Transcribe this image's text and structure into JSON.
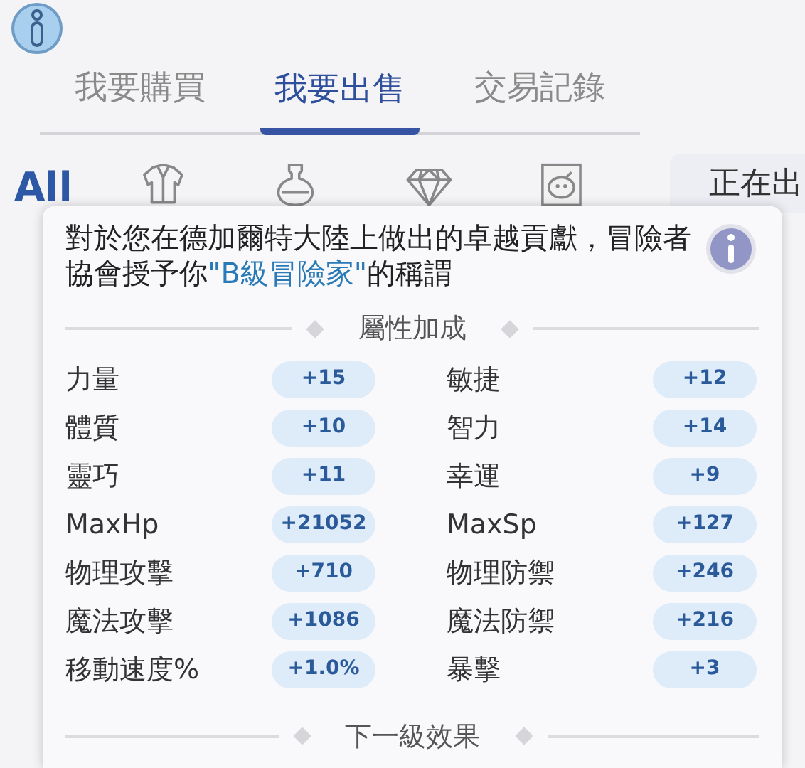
{
  "tabs": [
    {
      "label": "我要購買",
      "selected": false
    },
    {
      "label": "我要出售",
      "selected": true
    },
    {
      "label": "交易記錄",
      "selected": false
    }
  ],
  "categories": [
    {
      "kind": "text",
      "label": "All",
      "selected": true
    },
    {
      "kind": "armor",
      "selected": false
    },
    {
      "kind": "potion",
      "selected": false
    },
    {
      "kind": "gem",
      "selected": false
    },
    {
      "kind": "card",
      "selected": false
    }
  ],
  "side_tab": {
    "label": "正在出"
  },
  "popup": {
    "message": "對於您在德加爾特大陸上做出的卓越貢獻，冒險者協會授予你**\"B級冒險家\"**的稱謂",
    "section_title": "屬性加成",
    "stats": [
      {
        "label": "力量",
        "value": "+15"
      },
      {
        "label": "敏捷",
        "value": "+12"
      },
      {
        "label": "體質",
        "value": "+10"
      },
      {
        "label": "智力",
        "value": "+14"
      },
      {
        "label": "靈巧",
        "value": "+11"
      },
      {
        "label": "幸運",
        "value": "+9"
      },
      {
        "label": "MaxHp",
        "value": "+21052"
      },
      {
        "label": "MaxSp",
        "value": "+127"
      },
      {
        "label": "物理攻擊",
        "value": "+710"
      },
      {
        "label": "物理防禦",
        "value": "+246"
      },
      {
        "label": "魔法攻擊",
        "value": "+1086"
      },
      {
        "label": "魔法防禦",
        "value": "+216"
      },
      {
        "label": "移動速度%",
        "value": "+1.0%"
      },
      {
        "label": "暴擊",
        "value": "+3"
      }
    ],
    "next_section_title": "下一級效果"
  }
}
